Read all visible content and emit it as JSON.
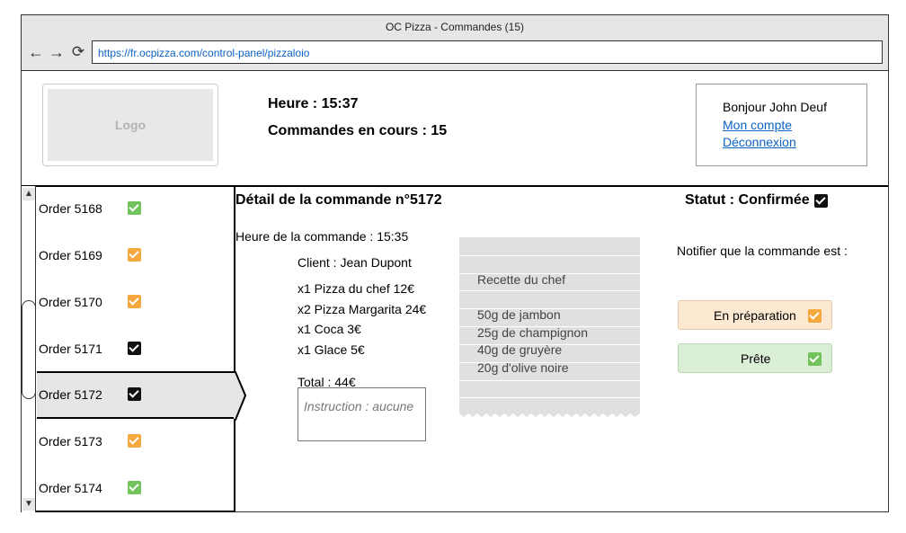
{
  "browser": {
    "title": "OC Pizza - Commandes (15)",
    "url": "https://fr.ocpizza.com/control-panel/pizzaloio",
    "back_icon": "arrow-left-icon",
    "forward_icon": "arrow-right-icon",
    "reload_icon": "reload-icon"
  },
  "header": {
    "logo": "Logo",
    "time": "Heure : 15:37",
    "orders_count": "Commandes en cours : 15",
    "user": {
      "greeting": "Bonjour John Deuf",
      "account_link": "Mon compte",
      "logout_link": "Déconnexion"
    }
  },
  "colors": {
    "green": "#72c35b",
    "orange": "#f4a83d",
    "black": "#111111"
  },
  "sidebar": {
    "orders": [
      {
        "label": "Order 5168",
        "status": "green"
      },
      {
        "label": "Order 5169",
        "status": "orange"
      },
      {
        "label": "Order 5170",
        "status": "orange"
      },
      {
        "label": "Order 5171",
        "status": "black"
      },
      {
        "label": "Order 5172",
        "status": "black",
        "selected": true
      },
      {
        "label": "Order 5173",
        "status": "orange"
      },
      {
        "label": "Order 5174",
        "status": "green"
      }
    ]
  },
  "detail": {
    "title": "Détail de la commande n°5172",
    "order_time": "Heure de la commande : 15:35",
    "client": "Client : Jean Dupont",
    "items": [
      "x1 Pizza du chef 12€",
      "x2 Pizza Margarita 24€",
      "x1 Coca 3€",
      "x1 Glace 5€"
    ],
    "total": "Total : 44€",
    "instruction": "Instruction : aucune"
  },
  "recipe": {
    "title": "Recette du chef",
    "ingredients": [
      "50g de jambon",
      "25g de champignon",
      "40g de gruyère",
      "20g d'olive noire"
    ]
  },
  "status": {
    "label": "Statut : Confirmée",
    "notify_label": "Notifier que la commande est :",
    "buttons": {
      "preparing": "En préparation",
      "ready": "Prête"
    }
  }
}
